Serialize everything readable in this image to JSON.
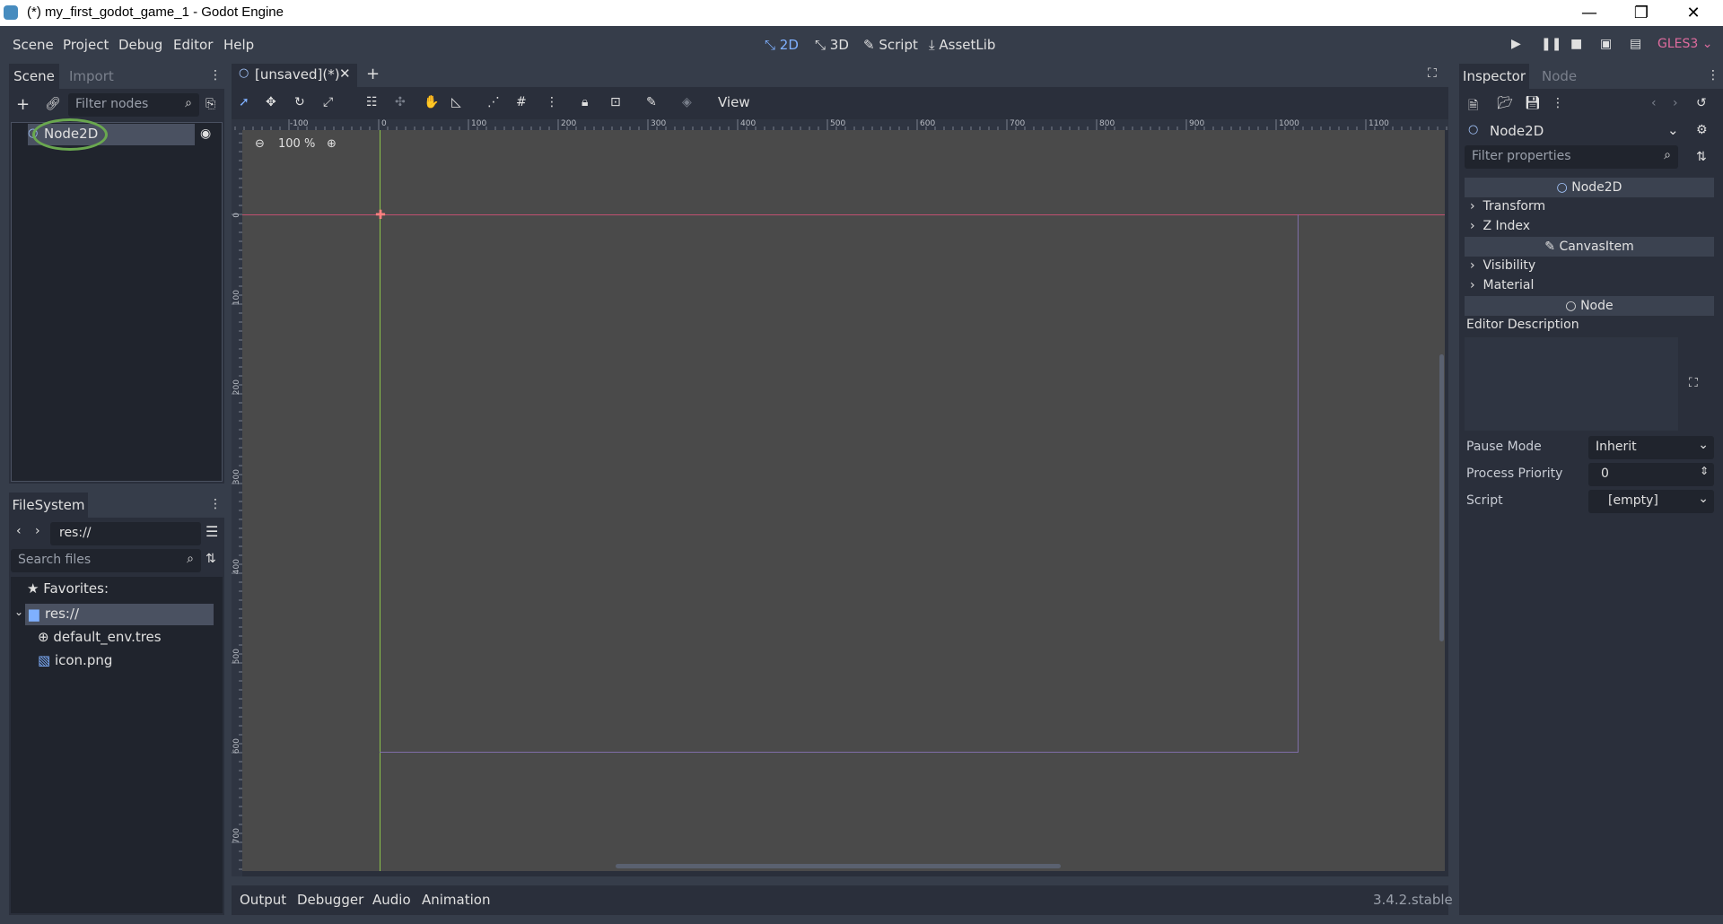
{
  "window": {
    "title": "(*) my_first_godot_game_1 - Godot Engine",
    "controls": [
      "—",
      "❐",
      "✕"
    ]
  },
  "menu": [
    "Scene",
    "Project",
    "Debug",
    "Editor",
    "Help"
  ],
  "workspaces": [
    {
      "label": "2D",
      "active": true
    },
    {
      "label": "3D",
      "active": false
    },
    {
      "label": "Script",
      "active": false
    },
    {
      "label": "AssetLib",
      "active": false
    }
  ],
  "renderer": "GLES3",
  "scene_dock": {
    "tabs": [
      "Scene",
      "Import"
    ],
    "filter_placeholder": "Filter nodes",
    "tree": [
      {
        "label": "Node2D"
      }
    ]
  },
  "filesystem_dock": {
    "tab": "FileSystem",
    "path": "res://",
    "search_placeholder": "Search files",
    "items": [
      {
        "label": "Favorites:"
      },
      {
        "label": "res://"
      },
      {
        "label": "default_env.tres"
      },
      {
        "label": "icon.png"
      }
    ]
  },
  "editor": {
    "scene_tab": "[unsaved](*)",
    "view_menu": "View",
    "zoom": "100 %",
    "ruler_h": [
      "-100",
      "0",
      "100",
      "200",
      "300",
      "400",
      "500",
      "600",
      "700",
      "800",
      "900",
      "1000",
      "1100"
    ],
    "ruler_v": [
      "0",
      "100",
      "200",
      "300",
      "400",
      "500",
      "600",
      "700"
    ]
  },
  "bottom_panel": {
    "tabs": [
      "Output",
      "Debugger",
      "Audio",
      "Animation"
    ],
    "version": "3.4.2.stable"
  },
  "inspector": {
    "tabs": [
      "Inspector",
      "Node"
    ],
    "object": "Node2D",
    "filter_placeholder": "Filter properties",
    "sections": {
      "node2d": "Node2D",
      "transform": "Transform",
      "zindex": "Z Index",
      "canvasitem": "CanvasItem",
      "visibility": "Visibility",
      "material": "Material",
      "node": "Node",
      "editor_description": "Editor Description"
    },
    "properties": [
      {
        "label": "Pause Mode",
        "value": "Inherit"
      },
      {
        "label": "Process Priority",
        "value": "0"
      },
      {
        "label": "Script",
        "value": "[empty]"
      }
    ]
  },
  "colors": {
    "accent": "#7fb0ff",
    "highlight_circle": "#6aa84f",
    "renderer": "#e06c9f",
    "origin_x_axis": "#c05070",
    "origin_y_axis": "#8bc34a"
  }
}
